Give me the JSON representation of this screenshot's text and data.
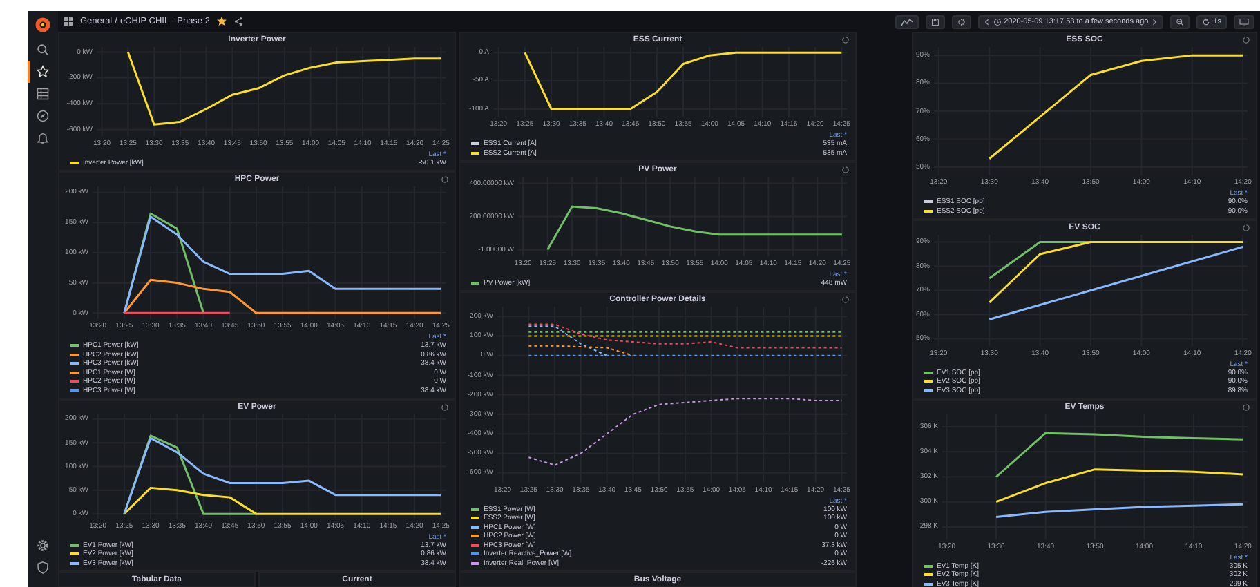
{
  "topbar": {
    "breadcrumb_folder": "General",
    "breadcrumb_separator": "/",
    "dashboard_title": "eCHIP CHIL - Phase 2",
    "starred": true,
    "time_range": "2020-05-09 13:17:53 to a few seconds ago",
    "refresh_interval": "1s"
  },
  "sidebar": {
    "items": [
      {
        "kind": "search",
        "selected": false
      },
      {
        "kind": "star",
        "selected": true
      },
      {
        "kind": "grid",
        "selected": false
      },
      {
        "kind": "compass",
        "selected": false
      },
      {
        "kind": "bell",
        "selected": false
      }
    ],
    "bottom_items": [
      {
        "kind": "gear",
        "selected": false
      },
      {
        "kind": "shield",
        "selected": false
      }
    ]
  },
  "columns": [
    {
      "panels": [
        {
          "title": "Inverter Power",
          "link_icon": false,
          "legend_header": "Last *",
          "legend": [
            {
              "value": "-50.1 kW"
            }
          ],
          "chart_data": {
            "type": "line",
            "grid": true,
            "ylim": [
              -650,
              40
            ],
            "categories": [
              "13:20",
              "13:25",
              "13:30",
              "13:35",
              "13:40",
              "13:45",
              "13:50",
              "13:55",
              "14:00",
              "14:05",
              "14:10",
              "14:15",
              "14:20",
              "14:25"
            ],
            "yticks": [
              {
                "value": 0,
                "label": "0 kW"
              },
              {
                "value": -200,
                "label": "-200 kW"
              },
              {
                "value": -400,
                "label": "-400 kW"
              },
              {
                "value": -600,
                "label": "-600 kW"
              }
            ],
            "series": [
              {
                "name": "Inverter Power [kW]",
                "color": "#fade2a",
                "values": [
                  null,
                  0,
                  -560,
                  -540,
                  -440,
                  -330,
                  -280,
                  -180,
                  -120,
                  -80,
                  -70,
                  -60,
                  -50,
                  -50
                ]
              }
            ]
          }
        },
        {
          "title": "HPC Power",
          "link_icon": true,
          "legend_header": "Last *",
          "legend": [
            {
              "value": "13.7 kW"
            },
            {
              "value": "0.86 kW"
            },
            {
              "value": "38.4 kW"
            },
            {
              "value": "0 W"
            },
            {
              "value": "0 W"
            },
            {
              "value": "38.4 kW"
            }
          ],
          "chart_data": {
            "type": "line",
            "grid": true,
            "ylim": [
              -10,
              210
            ],
            "categories": [
              "13:20",
              "13:25",
              "13:30",
              "13:35",
              "13:40",
              "13:45",
              "13:50",
              "13:55",
              "14:00",
              "14:05",
              "14:10",
              "14:15",
              "14:20",
              "14:25"
            ],
            "yticks": [
              {
                "value": 200,
                "label": "200 kW"
              },
              {
                "value": 150,
                "label": "150 kW"
              },
              {
                "value": 100,
                "label": "100 kW"
              },
              {
                "value": 50,
                "label": "50 kW"
              },
              {
                "value": 0,
                "label": "0 kW"
              }
            ],
            "series": [
              {
                "name": "HPC1 Power [kW]",
                "color": "#73bf69",
                "values": [
                  null,
                  0,
                  165,
                  140,
                  0,
                  null,
                  null,
                  null,
                  null,
                  null,
                  null,
                  null,
                  null,
                  null
                ]
              },
              {
                "name": "HPC2 Power [kW]",
                "color": "#ff9830",
                "values": [
                  null,
                  0,
                  55,
                  50,
                  40,
                  35,
                  0,
                  0,
                  0,
                  0,
                  0,
                  0,
                  0,
                  0
                ]
              },
              {
                "name": "HPC3 Power [kW]",
                "color": "#8ab8ff",
                "values": [
                  null,
                  0,
                  160,
                  130,
                  85,
                  65,
                  65,
                  65,
                  70,
                  40,
                  40,
                  40,
                  40,
                  40
                ]
              },
              {
                "name": "HPC1 Power [W]",
                "color": "#ff9830",
                "values": [
                  null,
                  null,
                  null,
                  null,
                  null,
                  null,
                  null,
                  null,
                  null,
                  null,
                  null,
                  null,
                  null,
                  null
                ]
              },
              {
                "name": "HPC2 Power [W]",
                "color": "#f2495c",
                "values": [
                  null,
                  0,
                  0,
                  0,
                  0,
                  0,
                  null,
                  null,
                  null,
                  null,
                  null,
                  null,
                  null,
                  null
                ]
              },
              {
                "name": "HPC3 Power [W]",
                "color": "#5794f2",
                "values": [
                  null,
                  null,
                  null,
                  null,
                  null,
                  null,
                  null,
                  null,
                  null,
                  null,
                  null,
                  null,
                  null,
                  null
                ]
              }
            ]
          }
        },
        {
          "title": "EV Power",
          "link_icon": true,
          "legend_header": "Last *",
          "legend": [
            {
              "value": "13.7 kW"
            },
            {
              "value": "0.86 kW"
            },
            {
              "value": "38.4 kW"
            }
          ],
          "chart_data": {
            "type": "line",
            "grid": true,
            "ylim": [
              -10,
              210
            ],
            "categories": [
              "13:20",
              "13:25",
              "13:30",
              "13:35",
              "13:40",
              "13:45",
              "13:50",
              "13:55",
              "14:00",
              "14:05",
              "14:10",
              "14:15",
              "14:20",
              "14:25"
            ],
            "yticks": [
              {
                "value": 200,
                "label": "200 kW"
              },
              {
                "value": 150,
                "label": "150 kW"
              },
              {
                "value": 100,
                "label": "100 kW"
              },
              {
                "value": 50,
                "label": "50 kW"
              },
              {
                "value": 0,
                "label": "0 kW"
              }
            ],
            "series": [
              {
                "name": "EV1 Power [kW]",
                "color": "#73bf69",
                "values": [
                  null,
                  0,
                  165,
                  140,
                  0,
                  0,
                  0,
                  null,
                  null,
                  null,
                  null,
                  null,
                  null,
                  null
                ]
              },
              {
                "name": "EV2 Power [kW]",
                "color": "#fade2a",
                "values": [
                  null,
                  0,
                  55,
                  50,
                  40,
                  35,
                  0,
                  0,
                  0,
                  0,
                  0,
                  0,
                  0,
                  0
                ]
              },
              {
                "name": "EV3 Power [kW]",
                "color": "#8ab8ff",
                "values": [
                  null,
                  0,
                  160,
                  130,
                  85,
                  65,
                  65,
                  65,
                  70,
                  40,
                  40,
                  40,
                  40,
                  40
                ]
              }
            ]
          }
        }
      ],
      "footer_panels": [
        {
          "title": "Tabular Data"
        },
        {
          "title": "Current"
        }
      ]
    },
    {
      "panels": [
        {
          "title": "ESS Current",
          "link_icon": true,
          "legend_header": "Last *",
          "legend": [
            {
              "value": "535 mA"
            },
            {
              "value": "535 mA"
            }
          ],
          "chart_data": {
            "type": "line",
            "grid": true,
            "ylim": [
              -115,
              10
            ],
            "categories": [
              "13:20",
              "13:25",
              "13:30",
              "13:35",
              "13:40",
              "13:45",
              "13:50",
              "13:55",
              "14:00",
              "14:05",
              "14:10",
              "14:15",
              "14:20",
              "14:25"
            ],
            "yticks": [
              {
                "value": 0,
                "label": "0 A"
              },
              {
                "value": -50,
                "label": "-50 A"
              },
              {
                "value": -100,
                "label": "-100 A"
              }
            ],
            "series": [
              {
                "name": "ESS1 Current [A]",
                "color": "#ccccdc",
                "values": [
                  null,
                  null,
                  null,
                  null,
                  null,
                  null,
                  null,
                  null,
                  null,
                  null,
                  null,
                  null,
                  null,
                  null
                ]
              },
              {
                "name": "ESS2 Current [A]",
                "color": "#fade2a",
                "values": [
                  null,
                  0,
                  -100,
                  -100,
                  -100,
                  -100,
                  -70,
                  -20,
                  -5,
                  0,
                  0,
                  0,
                  0,
                  0
                ]
              }
            ]
          }
        },
        {
          "title": "PV Power",
          "link_icon": true,
          "legend_header": "Last *",
          "legend": [
            {
              "value": "448 mW"
            }
          ],
          "chart_data": {
            "type": "line",
            "grid": true,
            "ylim": [
              -40,
              440
            ],
            "categories": [
              "13:20",
              "13:25",
              "13:30",
              "13:35",
              "13:40",
              "13:45",
              "13:50",
              "13:55",
              "14:00",
              "14:05",
              "14:10",
              "14:15",
              "14:20",
              "14:25"
            ],
            "yticks": [
              {
                "value": 400,
                "label": "400.00000 kW"
              },
              {
                "value": 200,
                "label": "200.00000 kW"
              },
              {
                "value": -1,
                "label": "-1.00000 W"
              }
            ],
            "series": [
              {
                "name": "PV Power [kW]",
                "color": "#73bf69",
                "values": [
                  null,
                  0,
                  260,
                  250,
                  220,
                  180,
                  140,
                  110,
                  90,
                  90,
                  90,
                  90,
                  90,
                  90
                ]
              }
            ]
          }
        },
        {
          "title": "Controller Power Details",
          "link_icon": true,
          "legend_header": "Last *",
          "legend": [
            {
              "value": "100 kW"
            },
            {
              "value": "100 kW"
            },
            {
              "value": "0 W"
            },
            {
              "value": "0 W"
            },
            {
              "value": "37.3 kW"
            },
            {
              "value": "0 W"
            },
            {
              "value": "-226 kW"
            }
          ],
          "chart_data": {
            "type": "line",
            "grid": true,
            "ylim": [
              -650,
              250
            ],
            "categories": [
              "13:20",
              "13:25",
              "13:30",
              "13:35",
              "13:40",
              "13:45",
              "13:50",
              "13:55",
              "14:00",
              "14:05",
              "14:10",
              "14:15",
              "14:20",
              "14:25"
            ],
            "yticks": [
              {
                "value": 200,
                "label": "200 kW"
              },
              {
                "value": 100,
                "label": "100 kW"
              },
              {
                "value": 0,
                "label": "0 W"
              },
              {
                "value": -100,
                "label": "-100 kW"
              },
              {
                "value": -200,
                "label": "-200 kW"
              },
              {
                "value": -300,
                "label": "-300 kW"
              },
              {
                "value": -400,
                "label": "-400 kW"
              },
              {
                "value": -500,
                "label": "-500 kW"
              },
              {
                "value": -600,
                "label": "-600 kW"
              }
            ],
            "series": [
              {
                "name": "ESS1 Power [W]",
                "color": "#73bf69",
                "line_style": "dashed",
                "values": [
                  null,
                  120,
                  120,
                  120,
                  120,
                  120,
                  120,
                  120,
                  120,
                  120,
                  120,
                  120,
                  120,
                  120
                ]
              },
              {
                "name": "ESS2 Power [W]",
                "color": "#fade2a",
                "line_style": "dashed",
                "values": [
                  null,
                  100,
                  100,
                  100,
                  100,
                  100,
                  100,
                  100,
                  100,
                  100,
                  100,
                  100,
                  100,
                  100
                ]
              },
              {
                "name": "HPC1 Power [W]",
                "color": "#8ab8ff",
                "line_style": "dashed",
                "values": [
                  null,
                  150,
                  150,
                  60,
                  0,
                  null,
                  null,
                  null,
                  null,
                  null,
                  null,
                  null,
                  null,
                  null
                ]
              },
              {
                "name": "HPC2 Power [W]",
                "color": "#ff9830",
                "line_style": "dashed",
                "values": [
                  null,
                  50,
                  50,
                  45,
                  40,
                  0,
                  null,
                  null,
                  null,
                  null,
                  null,
                  null,
                  null,
                  null
                ]
              },
              {
                "name": "HPC3 Power [W]",
                "color": "#f2495c",
                "line_style": "dashed",
                "values": [
                  null,
                  160,
                  160,
                  110,
                  80,
                  70,
                  60,
                  60,
                  70,
                  40,
                  40,
                  40,
                  40,
                  40
                ]
              },
              {
                "name": "Inverter Reactive_Power [W]",
                "color": "#5794f2",
                "line_style": "dashed",
                "values": [
                  null,
                  0,
                  0,
                  0,
                  0,
                  0,
                  0,
                  0,
                  0,
                  0,
                  0,
                  0,
                  0,
                  0
                ]
              },
              {
                "name": "Inverter Real_Power [W]",
                "color": "#ca95e5",
                "line_style": "dashed",
                "values": [
                  null,
                  -520,
                  -560,
                  -500,
                  -400,
                  -300,
                  -250,
                  -240,
                  -230,
                  -220,
                  -220,
                  -220,
                  -230,
                  -230
                ]
              }
            ]
          }
        }
      ],
      "footer_panels": [
        {
          "title": "Bus Voltage"
        }
      ]
    },
    {
      "panels": [
        {
          "title": "ESS SOC",
          "link_icon": true,
          "legend_header": "Last *",
          "legend": [
            {
              "value": "90.0%"
            },
            {
              "value": "90.0%"
            }
          ],
          "chart_data": {
            "type": "line",
            "grid": true,
            "ylim": [
              47,
              93
            ],
            "categories": [
              "13:20",
              "13:30",
              "13:40",
              "13:50",
              "14:00",
              "14:10",
              "14:20"
            ],
            "yticks": [
              {
                "value": 90,
                "label": "90%"
              },
              {
                "value": 80,
                "label": "80%"
              },
              {
                "value": 70,
                "label": "70%"
              },
              {
                "value": 60,
                "label": "60%"
              },
              {
                "value": 50,
                "label": "50%"
              }
            ],
            "series": [
              {
                "name": "ESS1 SOC [pp]",
                "color": "#ccccdc",
                "values": [
                  null,
                  null,
                  null,
                  null,
                  null,
                  null,
                  null
                ]
              },
              {
                "name": "ESS2 SOC [pp]",
                "color": "#fade2a",
                "values": [
                  null,
                  53,
                  68,
                  83,
                  88,
                  90,
                  90
                ]
              }
            ]
          }
        },
        {
          "title": "EV SOC",
          "link_icon": true,
          "legend_header": "Last *",
          "legend": [
            {
              "value": "90.0%"
            },
            {
              "value": "90.0%"
            },
            {
              "value": "89.8%"
            }
          ],
          "chart_data": {
            "type": "line",
            "grid": true,
            "ylim": [
              47,
              93
            ],
            "categories": [
              "13:20",
              "13:30",
              "13:40",
              "13:50",
              "14:00",
              "14:10",
              "14:20"
            ],
            "yticks": [
              {
                "value": 90,
                "label": "90%"
              },
              {
                "value": 80,
                "label": "80%"
              },
              {
                "value": 70,
                "label": "70%"
              },
              {
                "value": 60,
                "label": "60%"
              },
              {
                "value": 50,
                "label": "50%"
              }
            ],
            "series": [
              {
                "name": "EV1 SOC [pp]",
                "color": "#73bf69",
                "values": [
                  null,
                  75,
                  90,
                  90,
                  null,
                  null,
                  null
                ]
              },
              {
                "name": "EV2 SOC [pp]",
                "color": "#fade2a",
                "values": [
                  null,
                  65,
                  85,
                  90,
                  90,
                  90,
                  90
                ]
              },
              {
                "name": "EV3 SOC [pp]",
                "color": "#8ab8ff",
                "values": [
                  null,
                  58,
                  64,
                  70,
                  76,
                  82,
                  88
                ]
              }
            ]
          }
        },
        {
          "title": "EV Temps",
          "link_icon": true,
          "legend_header": "Last *",
          "legend": [
            {
              "value": "305 K"
            },
            {
              "value": "302 K"
            },
            {
              "value": "299 K"
            }
          ],
          "chart_data": {
            "type": "line",
            "grid": true,
            "ylim": [
              297,
              307
            ],
            "categories": [
              "13:20",
              "13:30",
              "13:40",
              "13:50",
              "14:00",
              "14:10",
              "14:20"
            ],
            "yticks": [
              {
                "value": 306,
                "label": "306 K"
              },
              {
                "value": 304,
                "label": "304 K"
              },
              {
                "value": 302,
                "label": "302 K"
              },
              {
                "value": 300,
                "label": "300 K"
              },
              {
                "value": 298,
                "label": "298 K"
              }
            ],
            "series": [
              {
                "name": "EV1 Temp [K]",
                "color": "#73bf69",
                "values": [
                  null,
                  302,
                  305.5,
                  305.4,
                  305.2,
                  305.1,
                  305
                ]
              },
              {
                "name": "EV2 Temp [K]",
                "color": "#fade2a",
                "values": [
                  null,
                  300,
                  301.5,
                  302.6,
                  302.5,
                  302.4,
                  302.2
                ]
              },
              {
                "name": "EV3 Temp [K]",
                "color": "#8ab8ff",
                "values": [
                  null,
                  298.8,
                  299.2,
                  299.4,
                  299.6,
                  299.7,
                  299.8
                ]
              }
            ]
          }
        }
      ]
    }
  ]
}
